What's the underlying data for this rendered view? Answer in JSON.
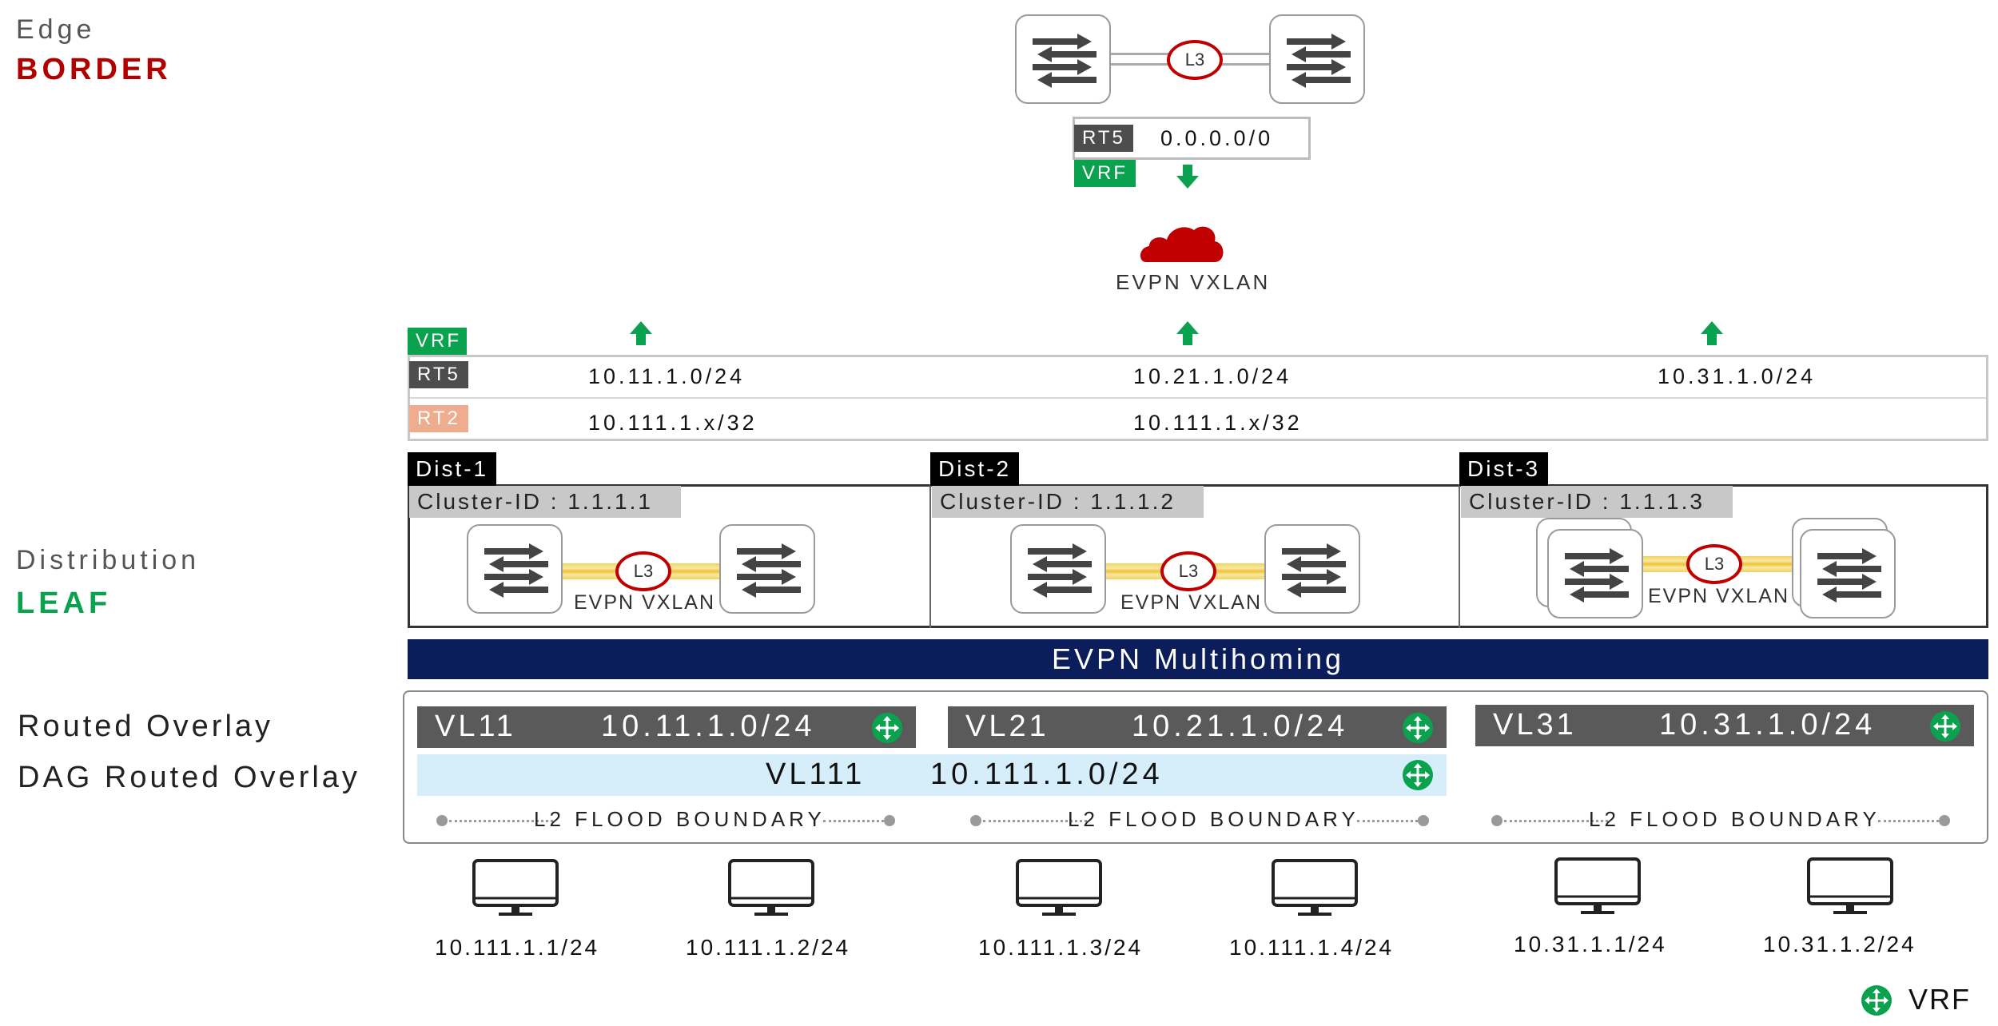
{
  "edge_label": "Edge",
  "border_label": "BORDER",
  "distribution_label": "Distribution",
  "leaf_label": "LEAF",
  "routed_overlay_label": "Routed Overlay",
  "dag_routed_overlay_label": "DAG Routed Overlay",
  "colors": {
    "border_red": "#b00000",
    "leaf_green": "#0aa24e",
    "vrf_green": "#0aa24e",
    "rt5_gray": "#4d4d4d",
    "rt2_salmon": "#efac8e",
    "multihoming_navy": "#0b1e5b",
    "l3_ring": "#c00000",
    "dag_bar": "#d6eef9"
  },
  "border": {
    "l3": "L3",
    "rt5_tag": "RT5",
    "rt5_route": "0.0.0.0/0",
    "vrf_tag": "VRF",
    "cloud_label": "EVPN VXLAN",
    "cloud_icon": "cloud-icon"
  },
  "routes": {
    "vrf_tag": "VRF",
    "rt5_tag": "RT5",
    "rt2_tag": "RT2",
    "rt5": [
      "10.11.1.0/24",
      "10.21.1.0/24",
      "10.31.1.0/24"
    ],
    "rt2": [
      "10.111.1.x/32",
      "10.111.1.x/32"
    ]
  },
  "dists": [
    {
      "name": "Dist-1",
      "cluster": "Cluster-ID : 1.1.1.1",
      "l3": "L3",
      "fabric": "EVPN VXLAN"
    },
    {
      "name": "Dist-2",
      "cluster": "Cluster-ID : 1.1.1.2",
      "l3": "L3",
      "fabric": "EVPN VXLAN"
    },
    {
      "name": "Dist-3",
      "cluster": "Cluster-ID : 1.1.1.3",
      "l3": "L3",
      "fabric": "EVPN VXLAN"
    }
  ],
  "multihoming": "EVPN Multihoming",
  "vlans": [
    {
      "name": "VL11",
      "net": "10.11.1.0/24"
    },
    {
      "name": "VL21",
      "net": "10.21.1.0/24"
    },
    {
      "name": "VL31",
      "net": "10.31.1.0/24"
    }
  ],
  "dag": {
    "name": "VL111",
    "net": "10.111.1.0/24"
  },
  "flood_boundary": [
    "L2 FLOOD BOUNDARY",
    "L2 FLOOD BOUNDARY",
    "L2 FLOOD BOUNDARY"
  ],
  "hosts": [
    "10.111.1.1/24",
    "10.111.1.2/24",
    "10.111.1.3/24",
    "10.111.1.4/24",
    "10.31.1.1/24",
    "10.31.1.2/24"
  ],
  "legend": {
    "icon": "vrf-icon",
    "label": "VRF"
  }
}
